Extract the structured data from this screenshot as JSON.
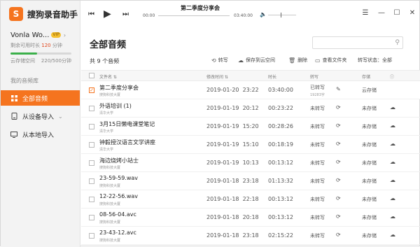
{
  "app": {
    "name": "搜狗录音助手",
    "logo_char": "S"
  },
  "user": {
    "name": "Vonla Wo...",
    "vip_badge": "VIP",
    "remaining_text": "剩余可用时长",
    "remaining_value": "120",
    "remaining_unit": "分钟",
    "usage_fraction": 0.44,
    "storage_label": "云存储空间",
    "storage_value": "220/500分钟"
  },
  "sidebar": {
    "section_label": "我的音频库",
    "items": [
      {
        "label": "全部音频",
        "icon": "grid-icon",
        "active": true
      },
      {
        "label": "从设备导入",
        "icon": "device-icon",
        "chevron": true
      },
      {
        "label": "从本地导入",
        "icon": "monitor-icon"
      }
    ]
  },
  "player": {
    "title": "第二季度分享会",
    "time_start": "00:00",
    "time_end": "03:40:00"
  },
  "page": {
    "title": "全部音频",
    "search_placeholder": "",
    "count_text": "共 9 个音频"
  },
  "toolbar": {
    "transcribe": "转写",
    "save_cloud": "保存到云空间",
    "delete": "删除",
    "open_folder": "查看文件夹",
    "status_label": "转写状态：",
    "status_value": "全部"
  },
  "table": {
    "headers": {
      "name": "文件名 ⇅",
      "modified": "修改时间 ⇅",
      "duration": "时长",
      "transcribe": "转写",
      "storage": "存储"
    },
    "rows": [
      {
        "name": "第二季度分享会",
        "sub": "搜狗科技大厦",
        "date": "2019-01-20",
        "time": "23:22",
        "duration": "03:40:00",
        "tr": "已转写",
        "tr_sub": "19283字",
        "action": "edit",
        "store": "云存储",
        "cloud": false,
        "checked": true
      },
      {
        "name": "外语培训 (1)",
        "sub": "清华大学",
        "date": "2019-01-19",
        "time": "20:12",
        "duration": "00:23:22",
        "tr": "未转写",
        "tr_sub": "",
        "action": "sync",
        "store": "未存储",
        "cloud": true,
        "checked": false
      },
      {
        "name": "3月15日懒电课堂笔记",
        "sub": "清华大学",
        "date": "2019-01-19",
        "time": "15:20",
        "duration": "00:28:26",
        "tr": "未转写",
        "tr_sub": "",
        "action": "sync",
        "store": "未存储",
        "cloud": true,
        "checked": false
      },
      {
        "name": "钟毅授汉语言文学讲座",
        "sub": "清华大学",
        "date": "2019-01-19",
        "time": "15:10",
        "duration": "00:18:19",
        "tr": "未转写",
        "tr_sub": "",
        "action": "sync",
        "store": "未存储",
        "cloud": true,
        "checked": false
      },
      {
        "name": "海边烧烤小站士",
        "sub": "搜狗科技大厦",
        "date": "2019-01-19",
        "time": "10:13",
        "duration": "00:13:12",
        "tr": "未转写",
        "tr_sub": "",
        "action": "sync",
        "store": "未存储",
        "cloud": true,
        "checked": false
      },
      {
        "name": "23-59-59.wav",
        "sub": "搜狗科技大厦",
        "date": "2019-01-18",
        "time": "23:18",
        "duration": "01:13:32",
        "tr": "未转写",
        "tr_sub": "",
        "action": "sync",
        "store": "未存储",
        "cloud": true,
        "checked": false
      },
      {
        "name": "12-22-56.wav",
        "sub": "搜狗科技大厦",
        "date": "2019-01-18",
        "time": "22:18",
        "duration": "00:13:12",
        "tr": "未转写",
        "tr_sub": "",
        "action": "sync",
        "store": "未存储",
        "cloud": true,
        "checked": false
      },
      {
        "name": "08-56-04.avc",
        "sub": "搜狗科技大厦",
        "date": "2019-01-18",
        "time": "20:18",
        "duration": "00:13:12",
        "tr": "未转写",
        "tr_sub": "",
        "action": "sync",
        "store": "未存储",
        "cloud": true,
        "checked": false
      },
      {
        "name": "23-43-12.avc",
        "sub": "搜狗科技大厦",
        "date": "2019-01-18",
        "time": "23:18",
        "duration": "02:15:22",
        "tr": "未转写",
        "tr_sub": "",
        "action": "sync",
        "store": "未存储",
        "cloud": true,
        "checked": false
      }
    ]
  },
  "colors": {
    "accent": "#f5741f",
    "progress": "#3bb04a"
  }
}
